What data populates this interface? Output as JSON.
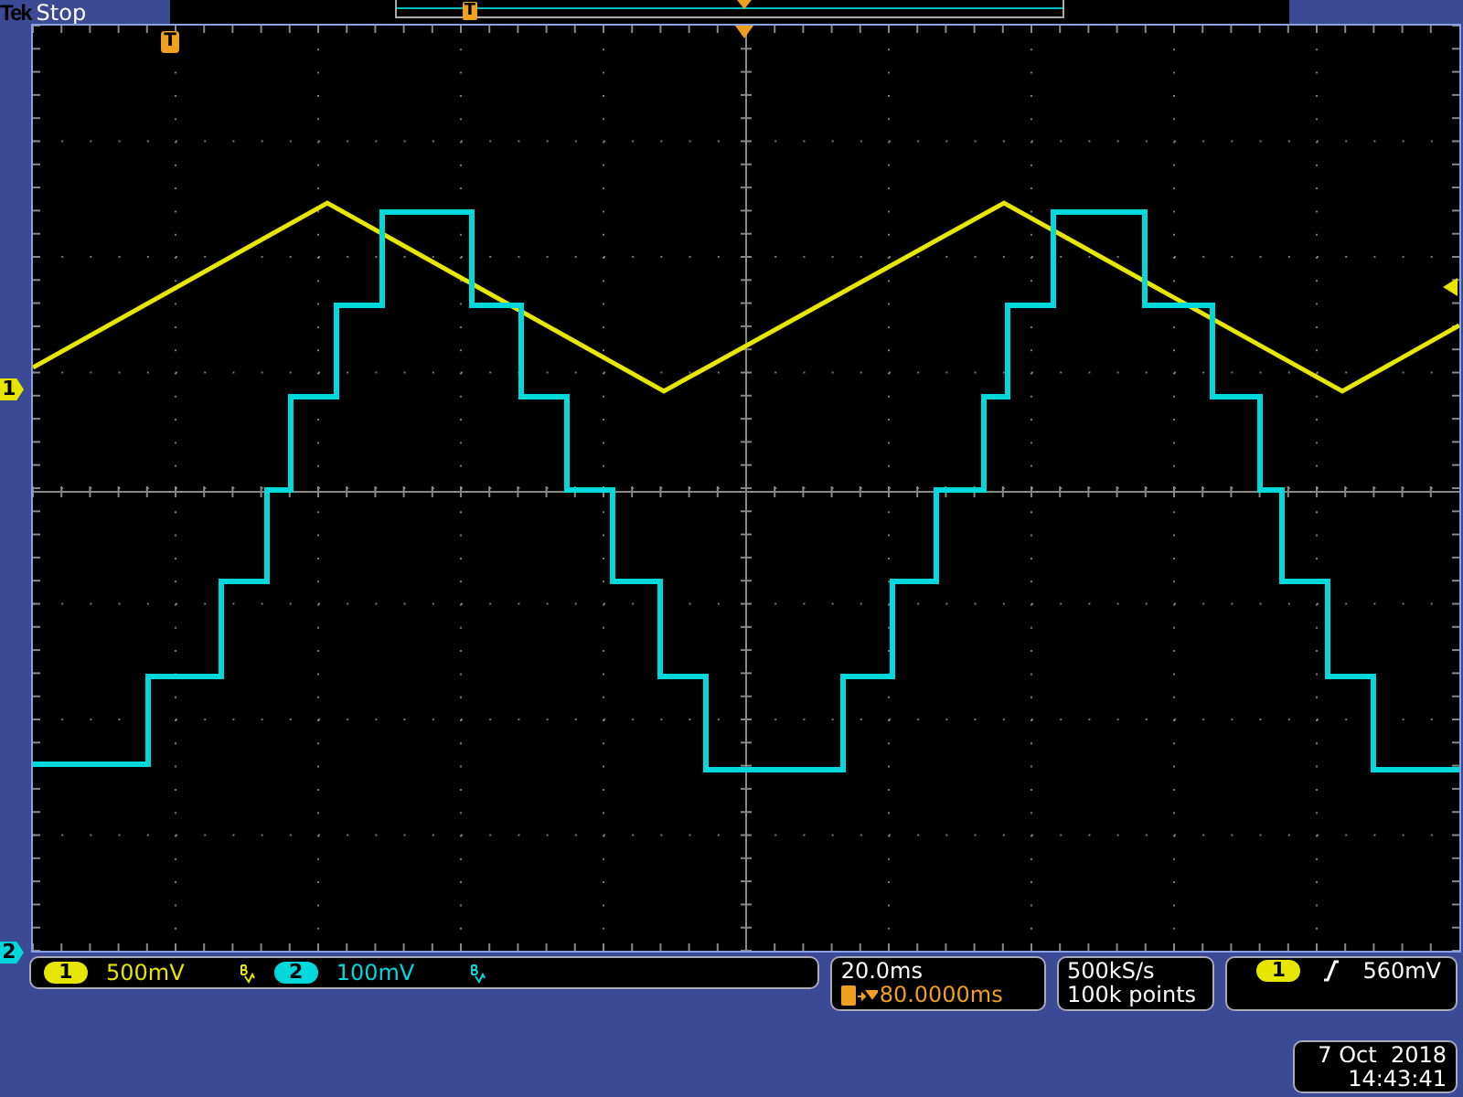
{
  "header": {
    "brand": "Tek",
    "state": "Stop"
  },
  "record_view": {
    "trigger_marker": "T"
  },
  "screen": {
    "trigger_marker": "T"
  },
  "channels": [
    {
      "marker_label": "1",
      "number": "1",
      "color": "#e6e600",
      "scale": "500mV"
    },
    {
      "marker_label": "2",
      "number": "2",
      "color": "#00d8dc",
      "scale": "100mV"
    }
  ],
  "timebase": {
    "scale": "20.0ms",
    "delay": "80.0000ms"
  },
  "acquisition": {
    "sample_rate": "500kS/s",
    "record_length": "100k points"
  },
  "trigger": {
    "source": "1",
    "color": "#e6e600",
    "level": "560mV"
  },
  "datetime": {
    "date": "7 Oct  2018",
    "time": "14:43:41"
  }
}
